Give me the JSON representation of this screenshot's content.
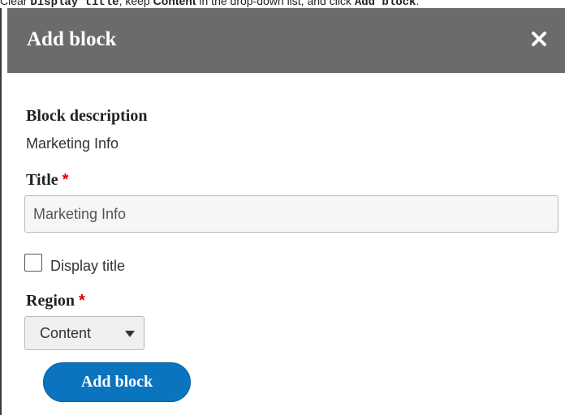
{
  "instruction": {
    "part1": "Clear ",
    "code1": "Display title",
    "part2": ", keep ",
    "bold1": "Content",
    "part3": " in the drop-down list, and click ",
    "code2": "Add block",
    "part4": "."
  },
  "dialog": {
    "title": "Add block",
    "close_icon": "close-icon",
    "header_color": "#6b6b6b"
  },
  "form": {
    "block_description": {
      "label": "Block description",
      "value": "Marketing Info"
    },
    "title": {
      "label": "Title",
      "required_mark": "*",
      "value": "Marketing Info"
    },
    "display_title": {
      "label": "Display title",
      "checked": false
    },
    "region": {
      "label": "Region",
      "required_mark": "*",
      "selected": "Content"
    },
    "submit_label": "Add block"
  },
  "colors": {
    "required": "#e00000",
    "primary_button": "#0a74bf"
  }
}
